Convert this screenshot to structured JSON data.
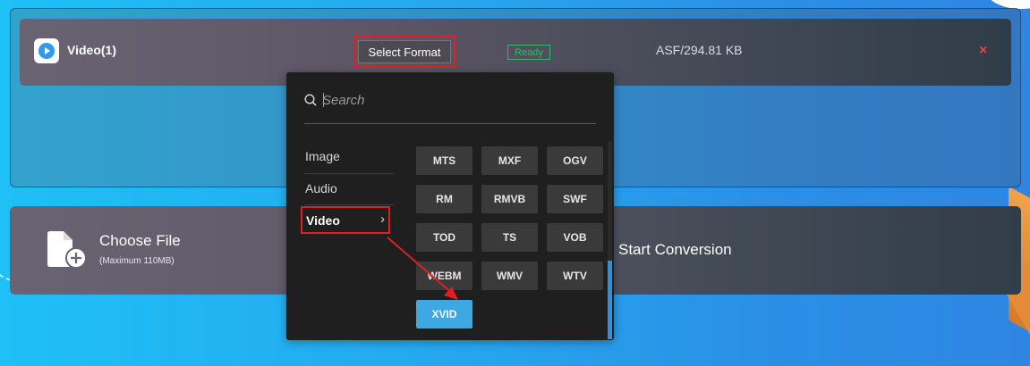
{
  "file_item": {
    "name": "Video(1)",
    "select_format_label": "Select Format",
    "status": "Ready",
    "info": "ASF/294.81 KB",
    "remove_symbol": "×"
  },
  "bottom": {
    "choose_title": "Choose File",
    "choose_sub": "(Maximum 110MB)",
    "start_label": "Start Conversion"
  },
  "dropdown": {
    "search_placeholder": "Search",
    "categories": [
      "Image",
      "Audio",
      "Video"
    ],
    "selected_category": "Video",
    "formats": [
      "MTS",
      "MXF",
      "OGV",
      "RM",
      "RMVB",
      "SWF",
      "TOD",
      "TS",
      "VOB",
      "WEBM",
      "WMV",
      "WTV",
      "XVID"
    ],
    "selected_format": "XVID"
  },
  "colors": {
    "accent": "#3ea8e2",
    "highlight": "#e02020",
    "ready": "#37b46a"
  }
}
